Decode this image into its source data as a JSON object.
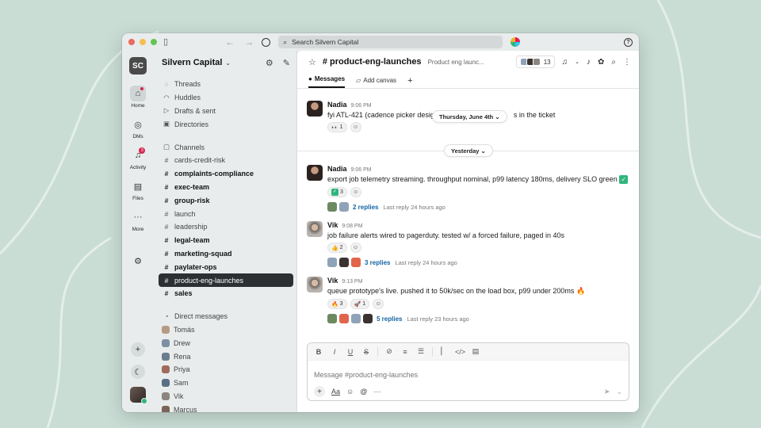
{
  "browser": {
    "search_placeholder": "Search Silvern Capital"
  },
  "rail": {
    "workspace_initials": "SC",
    "items": [
      {
        "label": "Home"
      },
      {
        "label": "DMs"
      },
      {
        "label": "Activity",
        "badge": "3"
      },
      {
        "label": "Files"
      },
      {
        "label": "More"
      }
    ]
  },
  "sidebar": {
    "workspace_name": "Silvern Capital",
    "top_items": [
      "Threads",
      "Huddles",
      "Drafts & sent",
      "Directories"
    ],
    "channels_header": "Channels",
    "channels": [
      {
        "name": "cards-credit-risk",
        "bold": false
      },
      {
        "name": "complaints-compliance",
        "bold": true
      },
      {
        "name": "exec-team",
        "bold": true
      },
      {
        "name": "group-risk",
        "bold": true
      },
      {
        "name": "launch",
        "bold": false
      },
      {
        "name": "leadership",
        "bold": false
      },
      {
        "name": "legal-team",
        "bold": true
      },
      {
        "name": "marketing-squad",
        "bold": true
      },
      {
        "name": "paylater-ops",
        "bold": true
      },
      {
        "name": "product-eng-launches",
        "bold": false,
        "selected": true
      },
      {
        "name": "sales",
        "bold": true
      }
    ],
    "dm_header": "Direct messages",
    "dms": [
      "Tomás",
      "Drew",
      "Rena",
      "Priya",
      "Sam",
      "Vik",
      "Marcus"
    ]
  },
  "channel": {
    "name": "# product-eng-launches",
    "topic": "Product eng launc...",
    "member_count": "13",
    "tabs": [
      "Messages",
      "Add canvas"
    ]
  },
  "messages": [
    {
      "author": "Nadia",
      "time": "9:06 PM",
      "text_before": "fyi ATL-421 (cadence picker desig",
      "text_after": "s in the ticket",
      "reactions": [
        {
          "emoji": "👀",
          "count": "1"
        }
      ],
      "date_pill": "Thursday, June 4th"
    },
    {
      "author": "Nadia",
      "time": "9:06 PM",
      "text": "export job telemetry streaming. throughput nominal, p99 latency 180ms, delivery SLO green",
      "reactions": [
        {
          "emoji": "✓",
          "count": "3"
        }
      ],
      "replies": "2 replies",
      "last_reply": "Last reply 24 hours ago"
    },
    {
      "author": "Vik",
      "time": "9:08 PM",
      "text": "job failure alerts wired to pagerduty. tested w/ a forced failure, paged in 40s",
      "reactions": [
        {
          "emoji": "👍",
          "count": "2"
        }
      ],
      "replies": "3 replies",
      "last_reply": "Last reply 24 hours ago"
    },
    {
      "author": "Vik",
      "time": "9:13 PM",
      "text": "queue prototype's live. pushed it to 50k/sec on the load box, p99 under 200ms",
      "reactions": [
        {
          "emoji": "🔥",
          "count": "3"
        },
        {
          "emoji": "🚀",
          "count": "1"
        }
      ],
      "replies": "5 replies",
      "last_reply": "Last reply 23 hours ago"
    }
  ],
  "divider_label": "Yesterday",
  "composer": {
    "placeholder": "Message #product-eng-launches"
  },
  "colors": {
    "selected_channel_bg": "#2d3032",
    "link_blue": "#1264a3",
    "badge_red": "#d5264f"
  }
}
